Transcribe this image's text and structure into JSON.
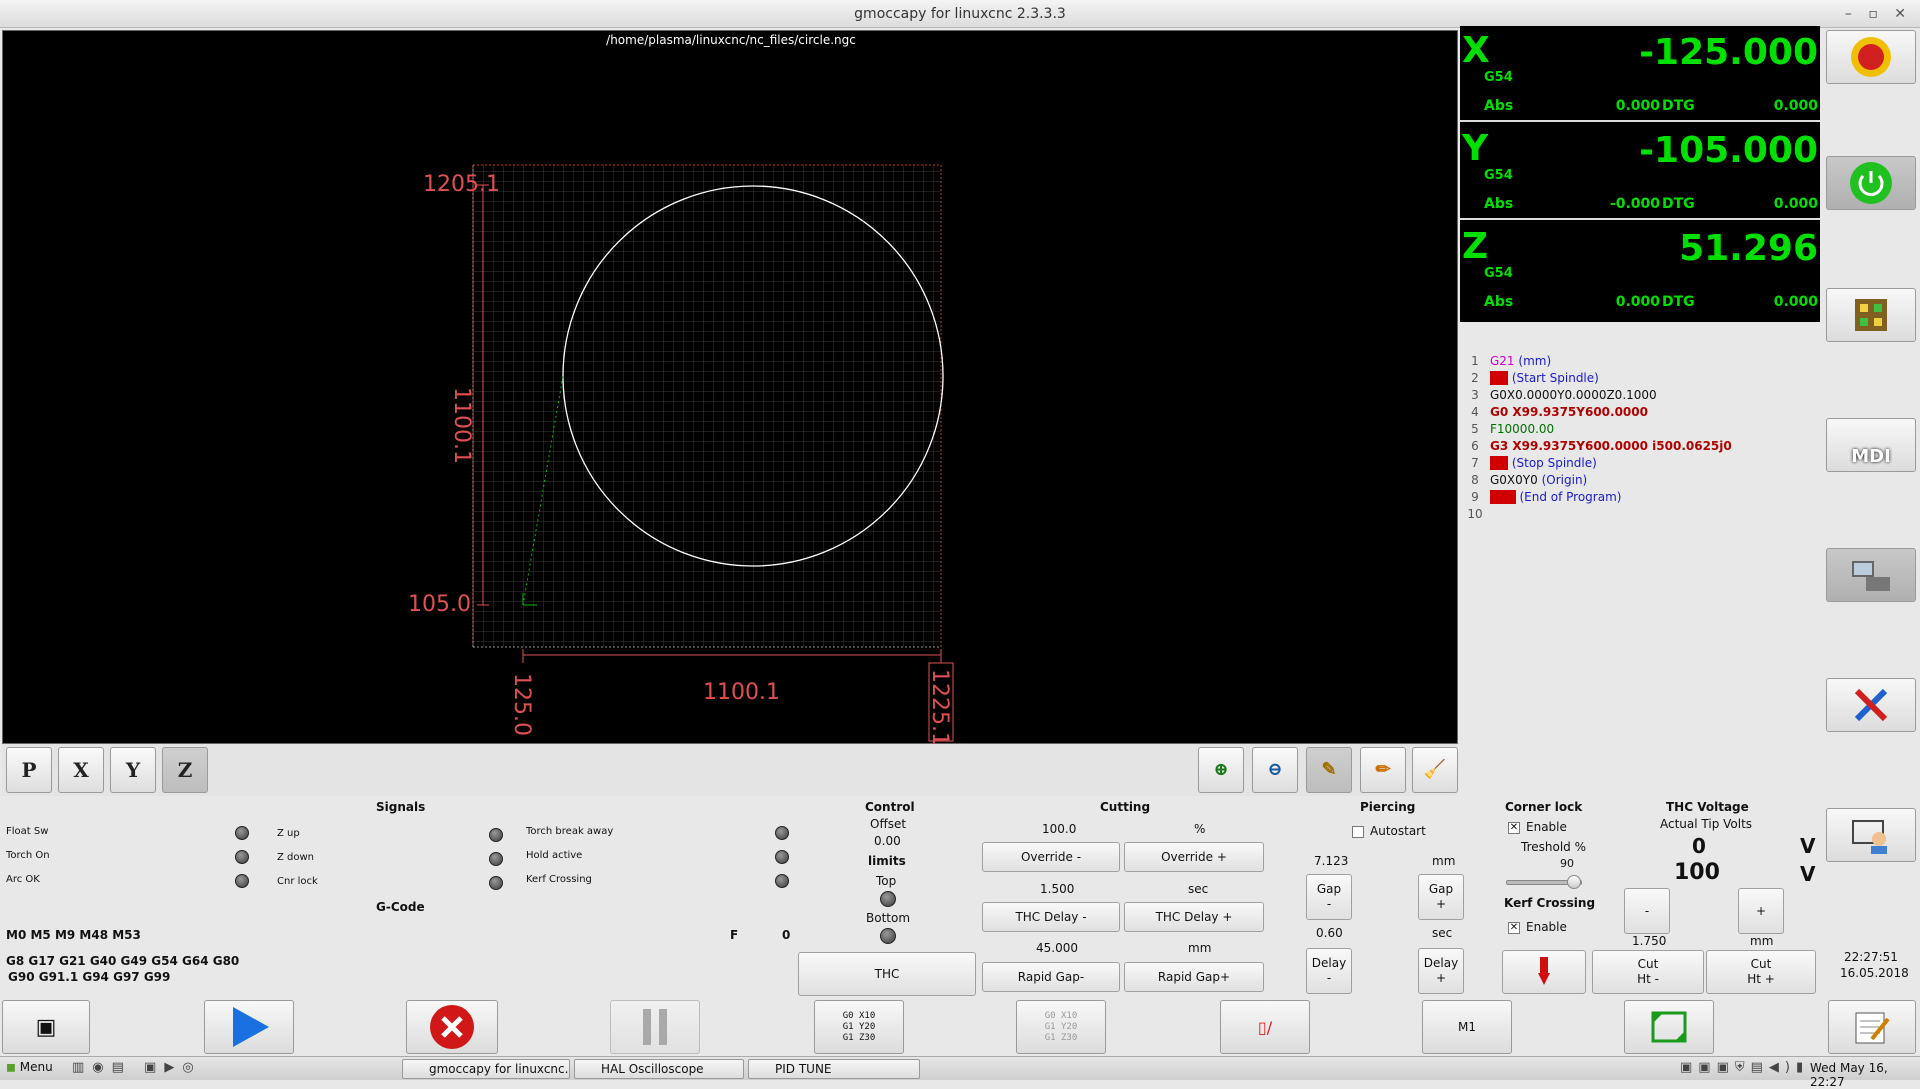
{
  "window": {
    "title": "gmoccapy for linuxcnc  2.3.3.3",
    "controls": "–  ▫  ✕"
  },
  "preview": {
    "file_path": "/home/plasma/linuxcnc/nc_files/circle.ngc",
    "dims": {
      "y_top": "1205.1",
      "y_mid": "1100.1",
      "y_bottom": "105.0",
      "x_mid": "1100.1",
      "x_left": "125.0",
      "x_right": "1225.1"
    }
  },
  "view_buttons": [
    {
      "name": "view-p-button",
      "label": "P"
    },
    {
      "name": "view-x-button",
      "label": "X"
    },
    {
      "name": "view-y-button",
      "label": "Y"
    },
    {
      "name": "view-z-button",
      "label": "Z"
    }
  ],
  "dro": [
    {
      "axis": "X",
      "system": "G54",
      "value": "-125.000",
      "abs_label": "Abs",
      "abs": "0.000",
      "dtg_label": "DTG",
      "dtg": "0.000"
    },
    {
      "axis": "Y",
      "system": "G54",
      "value": "-105.000",
      "abs_label": "Abs",
      "abs": "-0.000",
      "dtg_label": "DTG",
      "dtg": "0.000"
    },
    {
      "axis": "Z",
      "system": "G54",
      "value": "51.296",
      "abs_label": "Abs",
      "abs": "0.000",
      "dtg_label": "DTG",
      "dtg": "0.000"
    }
  ],
  "gcode_lines": [
    {
      "n": "1",
      "code": "G21",
      "comment": "(mm)"
    },
    {
      "n": "2",
      "code": "M3",
      "comment": "(Start Spindle)"
    },
    {
      "n": "3",
      "code": "G0X0.0000Y0.0000Z0.1000",
      "comment": ""
    },
    {
      "n": "4",
      "code": "G0 X99.9375Y600.0000",
      "comment": ""
    },
    {
      "n": "5",
      "code": "F10000.00",
      "comment": ""
    },
    {
      "n": "6",
      "code": "G3 X99.9375Y600.0000  i500.0625j0",
      "comment": ""
    },
    {
      "n": "7",
      "code": "M5",
      "comment": "(Stop Spindle)"
    },
    {
      "n": "8",
      "code": "G0X0Y0",
      "comment": "(Origin)"
    },
    {
      "n": "9",
      "code": "M30",
      "comment": "(End of Program)"
    },
    {
      "n": "10",
      "code": "",
      "comment": ""
    }
  ],
  "side_icons": [
    "estop-icon",
    "power-icon",
    "jog-panel-icon",
    "mdi-icon",
    "auto-mode-icon",
    "settings-tools-icon",
    "user-tabs-icon"
  ],
  "side_labels": {
    "mdi": "MDI"
  },
  "signals": {
    "title": "Signals",
    "col1": [
      "Float Sw",
      "Torch On",
      "Arc OK"
    ],
    "col2": [
      "Z up",
      "Z down",
      "Cnr lock"
    ],
    "col3": [
      "Torch break away",
      "Hold active",
      "Kerf Crossing"
    ]
  },
  "gcode_status": {
    "title": "G-Code",
    "mcodes": "M0 M5 M9 M48 M53",
    "f_label": "F",
    "f_value": "0",
    "gcodes_1": "G8 G17 G21 G40 G49 G54 G64 G80",
    "gcodes_2": "G90 G91.1 G94 G97 G99"
  },
  "control": {
    "title": "Control",
    "offset_label": "Offset",
    "offset_value": "0.00",
    "limits_label": "limits",
    "top_label": "Top",
    "bottom_label": "Bottom",
    "thc_button": "THC"
  },
  "cutting": {
    "title": "Cutting",
    "override_value": "100.0",
    "override_unit": "%",
    "override_minus": "Override -",
    "override_plus": "Override +",
    "thc_delay_value": "1.500",
    "thc_delay_unit": "sec",
    "thc_delay_minus": "THC Delay -",
    "thc_delay_plus": "THC Delay +",
    "rapid_gap_value": "45.000",
    "rapid_gap_unit": "mm",
    "rapid_gap_minus": "Rapid Gap-",
    "rapid_gap_plus": "Rapid Gap+"
  },
  "piercing": {
    "title": "Piercing",
    "autostart": "Autostart",
    "gap_value": "7.123",
    "gap_unit": "mm",
    "gap_minus_1": "Gap",
    "gap_minus_2": "-",
    "gap_plus_1": "Gap",
    "gap_plus_2": "+",
    "delay_value": "0.60",
    "delay_unit": "sec",
    "delay_minus_1": "Delay",
    "delay_minus_2": "-",
    "delay_plus_1": "Delay",
    "delay_plus_2": "+"
  },
  "corner_lock": {
    "title": "Corner lock",
    "enable": "Enable",
    "threshold_label": "Treshold %",
    "threshold_value": "90",
    "threshold_level": 0.9,
    "kerf_title": "Kerf Crossing",
    "kerf_enable": "Enable"
  },
  "thc_voltage": {
    "title": "THC Voltage",
    "subtitle": "Actual Tip Volts",
    "actual": "0",
    "target": "100",
    "unit": "V",
    "minus": "-",
    "plus": "+",
    "cut_height_value": "1.750",
    "cut_height_unit": "mm",
    "cut_ht_minus_1": "Cut",
    "cut_ht_minus_2": "Ht -",
    "cut_ht_plus_1": "Cut",
    "cut_ht_plus_2": "Ht +"
  },
  "clock": {
    "time": "22:27:51",
    "date": "16.05.2018"
  },
  "bottom_buttons": {
    "m1": "M1",
    "gcode_g0": "G0  X10",
    "gcode_g1": "G1  Y20",
    "gcode_g1b": "G1  Z30"
  },
  "taskbar": {
    "menu": "Menu",
    "tasks": [
      "gmoccapy for linuxcnc...",
      "HAL Oscilloscope",
      "PID TUNE"
    ],
    "clock": "Wed May 16, 22:27"
  }
}
